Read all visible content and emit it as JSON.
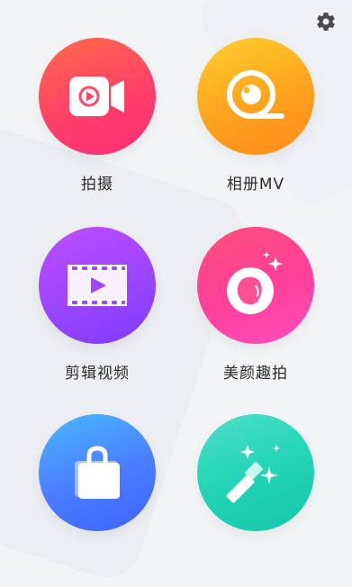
{
  "header": {
    "settings_icon": "gear-icon"
  },
  "features": [
    {
      "label": "拍摄",
      "icon": "video-camera-icon",
      "color": "#ff4a62"
    },
    {
      "label": "相册MV",
      "icon": "camera-lens-icon",
      "color": "#ffb323"
    },
    {
      "label": "剪辑视频",
      "icon": "film-play-icon",
      "color": "#a247ff"
    },
    {
      "label": "美颜趣拍",
      "icon": "beauty-face-icon",
      "color": "#ff4f95"
    },
    {
      "label": "",
      "icon": "shopping-bag-icon",
      "color": "#4a86ff"
    },
    {
      "label": "",
      "icon": "magic-wand-icon",
      "color": "#20d0b4"
    }
  ]
}
